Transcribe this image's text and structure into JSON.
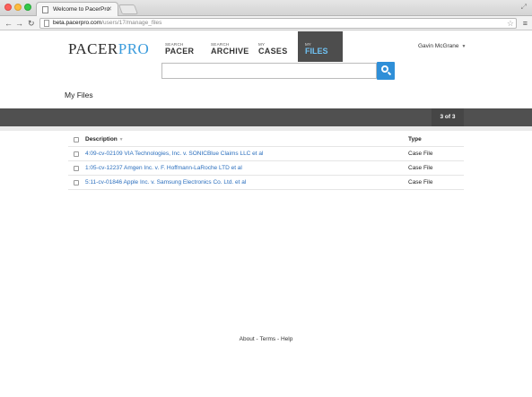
{
  "browser": {
    "tab_title": "Welcome to PacerPro",
    "url_host": "beta.pacerpro.com",
    "url_path": "/users/17/manage_files"
  },
  "header": {
    "logo_pacer": "PACER",
    "logo_pro": "PRO",
    "nav": [
      {
        "small": "SEARCH",
        "big": "PACER"
      },
      {
        "small": "SEARCH",
        "big": "ARCHIVE"
      },
      {
        "small": "MY",
        "big": "CASES"
      },
      {
        "small": "MY",
        "big": "FILES"
      }
    ],
    "user_name": "Gavin McGrane"
  },
  "search": {
    "value": "",
    "placeholder": ""
  },
  "page": {
    "title": "My Files",
    "count": "3 of 3"
  },
  "table": {
    "columns": [
      "Description",
      "Type"
    ],
    "rows": [
      {
        "description": "4:09-cv-02109 VIA Technologies, Inc. v. SONICBlue Claims LLC et al",
        "type": "Case File"
      },
      {
        "description": "1:05-cv-12237 Amgen Inc. v. F. Hoffmann-LaRoche LTD et al",
        "type": "Case File"
      },
      {
        "description": "5:11-cv-01846 Apple Inc. v. Samsung Electronics Co. Ltd. et al",
        "type": "Case File"
      }
    ]
  },
  "footer": {
    "about": "About",
    "terms": "Terms",
    "help": "Help",
    "sep": " - "
  },
  "colors": {
    "accent": "#2f8fd8",
    "link": "#2a6ebd",
    "active_nav_bg": "#4d4d4d",
    "bar_bg": "#505050"
  }
}
